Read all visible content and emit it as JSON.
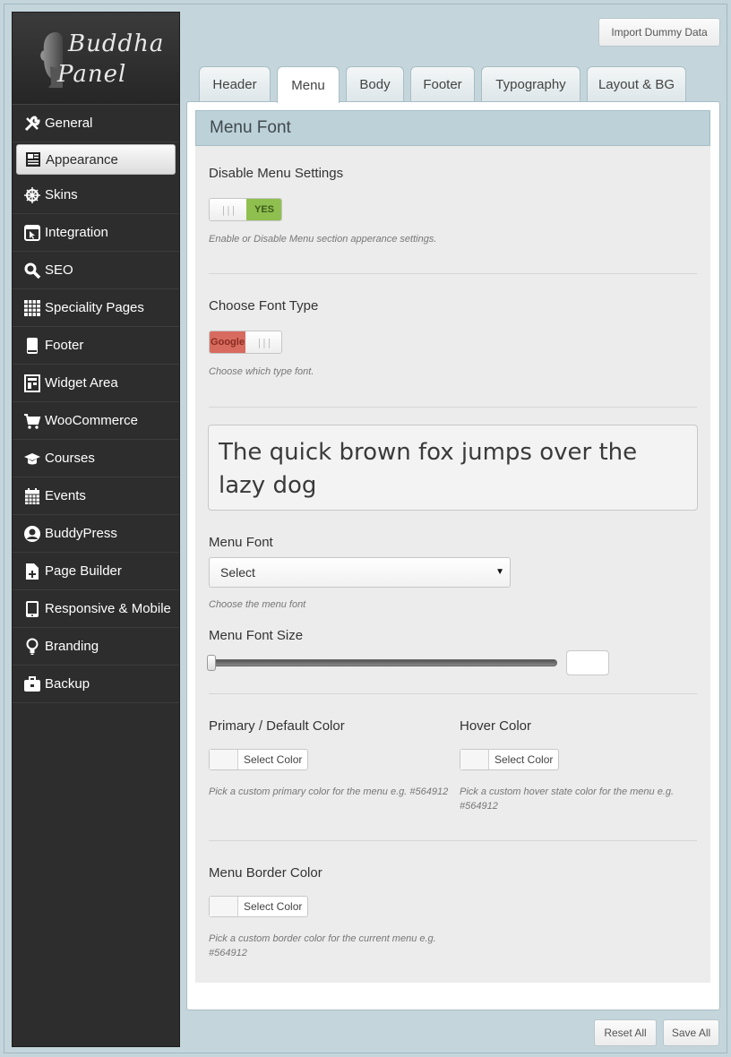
{
  "brand": {
    "line1": "Buddha",
    "line2": "Panel"
  },
  "sidebar": {
    "items": [
      {
        "label": "General",
        "icon": "wrench-icon"
      },
      {
        "label": "Appearance",
        "icon": "newspaper-icon",
        "active": true
      },
      {
        "label": "Skins",
        "icon": "ship-wheel-icon"
      },
      {
        "label": "Integration",
        "icon": "window-cursor-icon"
      },
      {
        "label": "SEO",
        "icon": "search-icon"
      },
      {
        "label": "Speciality Pages",
        "icon": "grid-icon"
      },
      {
        "label": "Footer",
        "icon": "page-icon"
      },
      {
        "label": "Widget Area",
        "icon": "widgets-icon"
      },
      {
        "label": "WooCommerce",
        "icon": "cart-icon"
      },
      {
        "label": "Courses",
        "icon": "graduation-cap-icon"
      },
      {
        "label": "Events",
        "icon": "calendar-icon"
      },
      {
        "label": "BuddyPress",
        "icon": "user-circle-icon"
      },
      {
        "label": "Page Builder",
        "icon": "page-add-icon"
      },
      {
        "label": "Responsive & Mobile",
        "icon": "tablet-icon"
      },
      {
        "label": "Branding",
        "icon": "lightbulb-icon"
      },
      {
        "label": "Backup",
        "icon": "briefcase-icon"
      }
    ]
  },
  "import_button": "Import Dummy Data",
  "tabs": [
    {
      "label": "Header"
    },
    {
      "label": "Menu",
      "active": true
    },
    {
      "label": "Body"
    },
    {
      "label": "Footer"
    },
    {
      "label": "Typography"
    },
    {
      "label": "Layout & BG"
    }
  ],
  "section": {
    "title": "Menu Font",
    "disable": {
      "label": "Disable Menu Settings",
      "toggle_value": "YES",
      "hint": "Enable or Disable Menu section apperance settings."
    },
    "font_type": {
      "label": "Choose Font Type",
      "toggle_value": "Google",
      "hint": "Choose which type font."
    },
    "preview_text": "The quick brown fox jumps over the lazy dog",
    "menu_font": {
      "label": "Menu Font",
      "selected": "Select",
      "hint": "Choose the menu font"
    },
    "font_size": {
      "label": "Menu Font Size",
      "value": 0
    },
    "primary_color": {
      "label": "Primary / Default Color",
      "button": "Select Color",
      "hint": "Pick a custom primary color for the menu e.g. #564912"
    },
    "hover_color": {
      "label": "Hover Color",
      "button": "Select Color",
      "hint": "Pick a custom hover state color for the menu e.g. #564912"
    },
    "border_color": {
      "label": "Menu Border Color",
      "button": "Select Color",
      "hint": "Pick a custom border color for the current menu e.g. #564912"
    }
  },
  "footer_buttons": {
    "reset": "Reset All",
    "save": "Save All"
  },
  "colors": {
    "toggle_yes": "#8fc04f",
    "toggle_google": "#d86b5f",
    "section_header": "#bdd1d8",
    "sidebar_bg": "#2d2d2d"
  }
}
